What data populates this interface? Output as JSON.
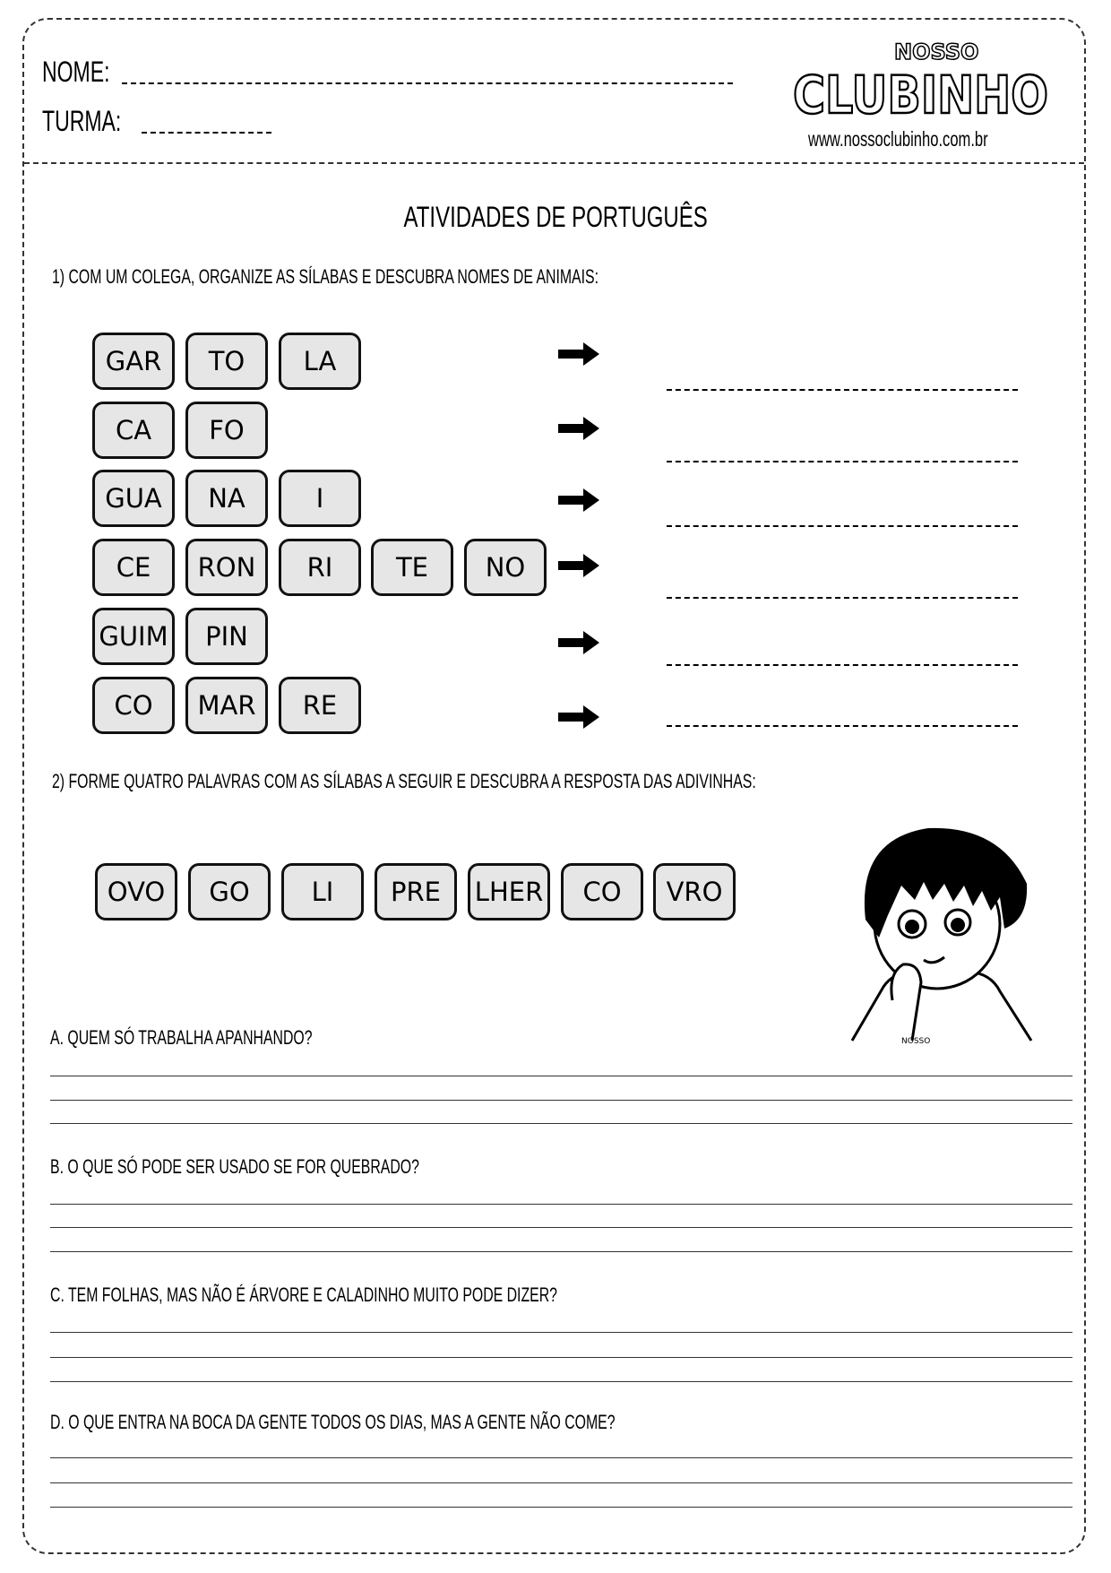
{
  "header": {
    "name_label": "NOME:",
    "class_label": "TURMA:",
    "logo_top": "NOSSO",
    "logo_main": "CLUBINHO",
    "website": "www.nossoclubinho.com.br"
  },
  "title": "ATIVIDADES DE PORTUGUÊS",
  "exercise1": {
    "instruction": "1) COM UM COLEGA, ORGANIZE AS SÍLABAS E DESCUBRA NOMES DE ANIMAIS:",
    "rows": [
      [
        "GAR",
        "TO",
        "LA"
      ],
      [
        "CA",
        "FO"
      ],
      [
        "GUA",
        "NA",
        "I"
      ],
      [
        "CE",
        "RON",
        "RI",
        "TE",
        "NO"
      ],
      [
        "GUIM",
        "PIN"
      ],
      [
        "CO",
        "MAR",
        "RE"
      ]
    ],
    "arrow_icon": "right-arrow"
  },
  "exercise2": {
    "instruction": "2) FORME QUATRO PALAVRAS COM AS SÍLABAS A SEGUIR E DESCUBRA A RESPOSTA DAS ADIVINHAS:",
    "syllables": [
      "OVO",
      "GO",
      "LI",
      "PRE",
      "LHER",
      "CO",
      "VRO"
    ],
    "illustration_text": "NOSSO",
    "riddles": [
      "A. QUEM SÓ TRABALHA APANHANDO?",
      "B. O QUE SÓ PODE SER USADO SE FOR QUEBRADO?",
      "C. TEM FOLHAS, MAS NÃO É ÁRVORE E CALADINHO MUITO PODE DIZER?",
      "D. O QUE ENTRA NA BOCA DA GENTE TODOS OS DIAS, MAS A GENTE NÃO COME?"
    ]
  }
}
